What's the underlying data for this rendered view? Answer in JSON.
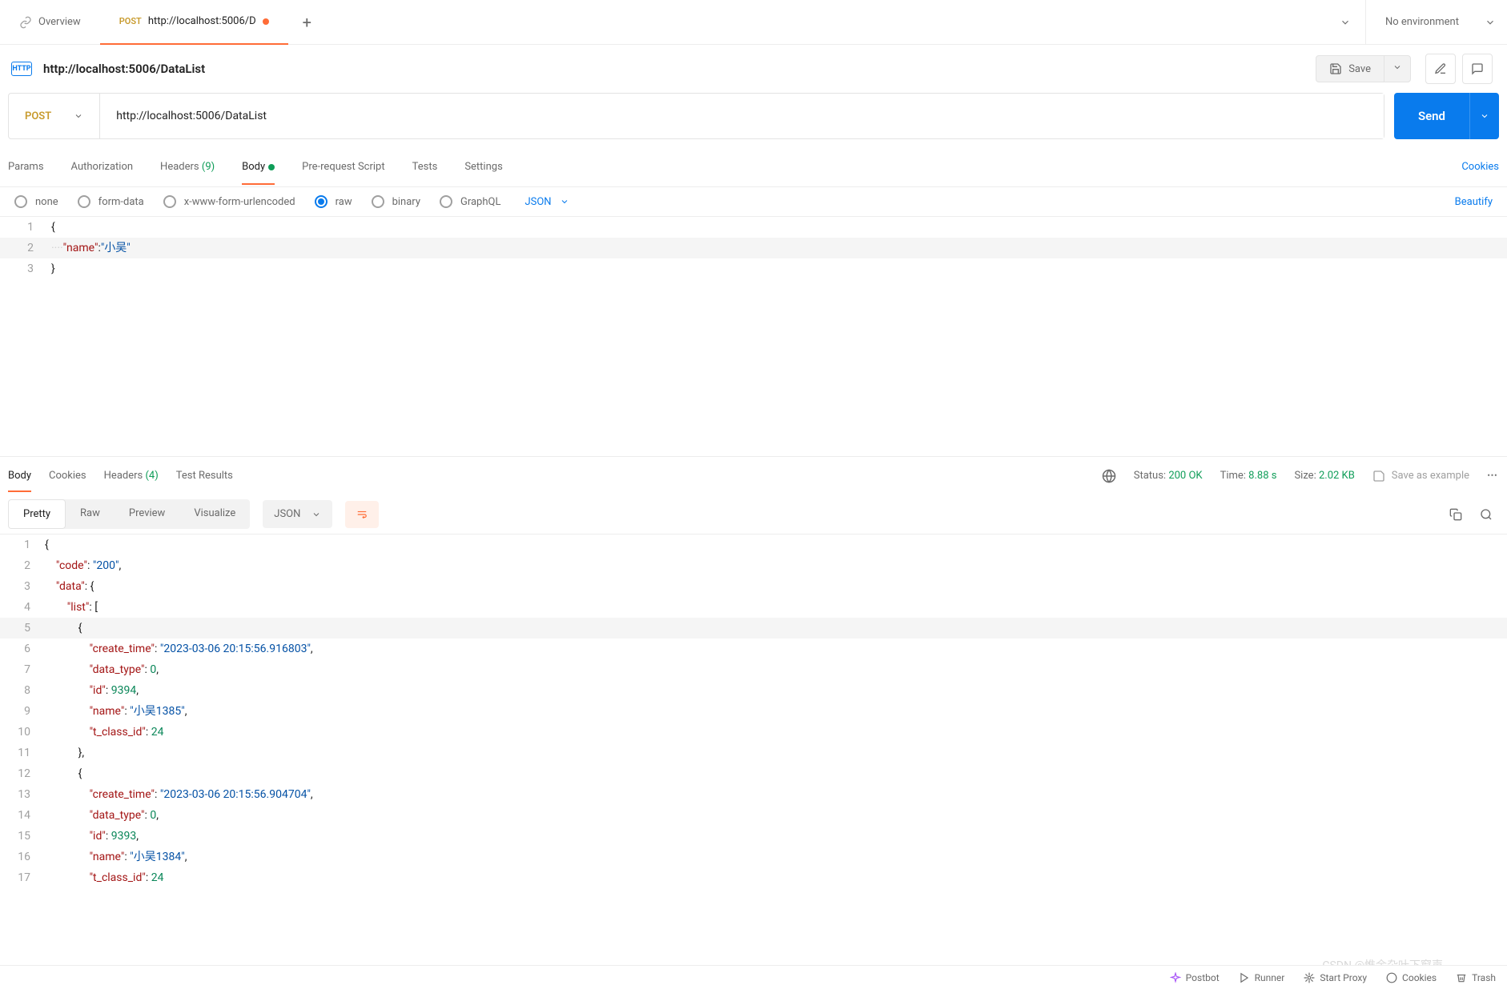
{
  "tabs": {
    "overview": "Overview",
    "active": {
      "method": "POST",
      "title": "http://localhost:5006/D"
    }
  },
  "environment": {
    "label": "No environment"
  },
  "request": {
    "title": "http://localhost:5006/DataList",
    "method": "POST",
    "url": "http://localhost:5006/DataList",
    "saveLabel": "Save",
    "sendLabel": "Send"
  },
  "reqTabs": {
    "params": "Params",
    "authorization": "Authorization",
    "headers": "Headers",
    "headersCount": "(9)",
    "body": "Body",
    "prerequest": "Pre-request Script",
    "tests": "Tests",
    "settings": "Settings",
    "cookies": "Cookies"
  },
  "bodyTypes": {
    "none": "none",
    "formdata": "form-data",
    "xwww": "x-www-form-urlencoded",
    "raw": "raw",
    "binary": "binary",
    "graphql": "GraphQL",
    "format": "JSON",
    "beautify": "Beautify"
  },
  "requestBody": {
    "line1_num": "1",
    "line1": "{",
    "line2_num": "2",
    "line2_key": "\"name\"",
    "line2_val": "\"小吴\"",
    "line3_num": "3",
    "line3": "}"
  },
  "respTabs": {
    "body": "Body",
    "cookies": "Cookies",
    "headers": "Headers",
    "headersCount": "(4)",
    "testResults": "Test Results"
  },
  "respStatus": {
    "statusLabel": "Status:",
    "statusValue": "200 OK",
    "timeLabel": "Time:",
    "timeValue": "8.88 s",
    "sizeLabel": "Size:",
    "sizeValue": "2.02 KB",
    "saveExample": "Save as example"
  },
  "viewTabs": {
    "pretty": "Pretty",
    "raw": "Raw",
    "preview": "Preview",
    "visualize": "Visualize",
    "format": "JSON"
  },
  "responseBody": [
    {
      "n": "1",
      "indent": 0,
      "tokens": [
        {
          "t": "p",
          "v": "{"
        }
      ]
    },
    {
      "n": "2",
      "indent": 1,
      "tokens": [
        {
          "t": "k",
          "v": "\"code\""
        },
        {
          "t": "p",
          "v": ": "
        },
        {
          "t": "s",
          "v": "\"200\""
        },
        {
          "t": "p",
          "v": ","
        }
      ]
    },
    {
      "n": "3",
      "indent": 1,
      "tokens": [
        {
          "t": "k",
          "v": "\"data\""
        },
        {
          "t": "p",
          "v": ": {"
        }
      ]
    },
    {
      "n": "4",
      "indent": 2,
      "tokens": [
        {
          "t": "k",
          "v": "\"list\""
        },
        {
          "t": "p",
          "v": ": ["
        }
      ]
    },
    {
      "n": "5",
      "indent": 3,
      "hl": true,
      "tokens": [
        {
          "t": "p",
          "v": "{"
        }
      ]
    },
    {
      "n": "6",
      "indent": 4,
      "tokens": [
        {
          "t": "k",
          "v": "\"create_time\""
        },
        {
          "t": "p",
          "v": ": "
        },
        {
          "t": "s",
          "v": "\"2023-03-06 20:15:56.916803\""
        },
        {
          "t": "p",
          "v": ","
        }
      ]
    },
    {
      "n": "7",
      "indent": 4,
      "tokens": [
        {
          "t": "k",
          "v": "\"data_type\""
        },
        {
          "t": "p",
          "v": ": "
        },
        {
          "t": "n",
          "v": "0"
        },
        {
          "t": "p",
          "v": ","
        }
      ]
    },
    {
      "n": "8",
      "indent": 4,
      "tokens": [
        {
          "t": "k",
          "v": "\"id\""
        },
        {
          "t": "p",
          "v": ": "
        },
        {
          "t": "n",
          "v": "9394"
        },
        {
          "t": "p",
          "v": ","
        }
      ]
    },
    {
      "n": "9",
      "indent": 4,
      "tokens": [
        {
          "t": "k",
          "v": "\"name\""
        },
        {
          "t": "p",
          "v": ": "
        },
        {
          "t": "s",
          "v": "\"小吴1385\""
        },
        {
          "t": "p",
          "v": ","
        }
      ]
    },
    {
      "n": "10",
      "indent": 4,
      "tokens": [
        {
          "t": "k",
          "v": "\"t_class_id\""
        },
        {
          "t": "p",
          "v": ": "
        },
        {
          "t": "n",
          "v": "24"
        }
      ]
    },
    {
      "n": "11",
      "indent": 3,
      "tokens": [
        {
          "t": "p",
          "v": "},"
        }
      ]
    },
    {
      "n": "12",
      "indent": 3,
      "tokens": [
        {
          "t": "p",
          "v": "{"
        }
      ]
    },
    {
      "n": "13",
      "indent": 4,
      "tokens": [
        {
          "t": "k",
          "v": "\"create_time\""
        },
        {
          "t": "p",
          "v": ": "
        },
        {
          "t": "s",
          "v": "\"2023-03-06 20:15:56.904704\""
        },
        {
          "t": "p",
          "v": ","
        }
      ]
    },
    {
      "n": "14",
      "indent": 4,
      "tokens": [
        {
          "t": "k",
          "v": "\"data_type\""
        },
        {
          "t": "p",
          "v": ": "
        },
        {
          "t": "n",
          "v": "0"
        },
        {
          "t": "p",
          "v": ","
        }
      ]
    },
    {
      "n": "15",
      "indent": 4,
      "tokens": [
        {
          "t": "k",
          "v": "\"id\""
        },
        {
          "t": "p",
          "v": ": "
        },
        {
          "t": "n",
          "v": "9393"
        },
        {
          "t": "p",
          "v": ","
        }
      ]
    },
    {
      "n": "16",
      "indent": 4,
      "tokens": [
        {
          "t": "k",
          "v": "\"name\""
        },
        {
          "t": "p",
          "v": ": "
        },
        {
          "t": "s",
          "v": "\"小吴1384\""
        },
        {
          "t": "p",
          "v": ","
        }
      ]
    },
    {
      "n": "17",
      "indent": 4,
      "tokens": [
        {
          "t": "k",
          "v": "\"t_class_id\""
        },
        {
          "t": "p",
          "v": ": "
        },
        {
          "t": "n",
          "v": "24"
        }
      ]
    }
  ],
  "footer": {
    "postbot": "Postbot",
    "runner": "Runner",
    "startProxy": "Start Proxy",
    "cookies": "Cookies",
    "trash": "Trash"
  },
  "watermark": "CSDN @惟余杂叶下窗声"
}
